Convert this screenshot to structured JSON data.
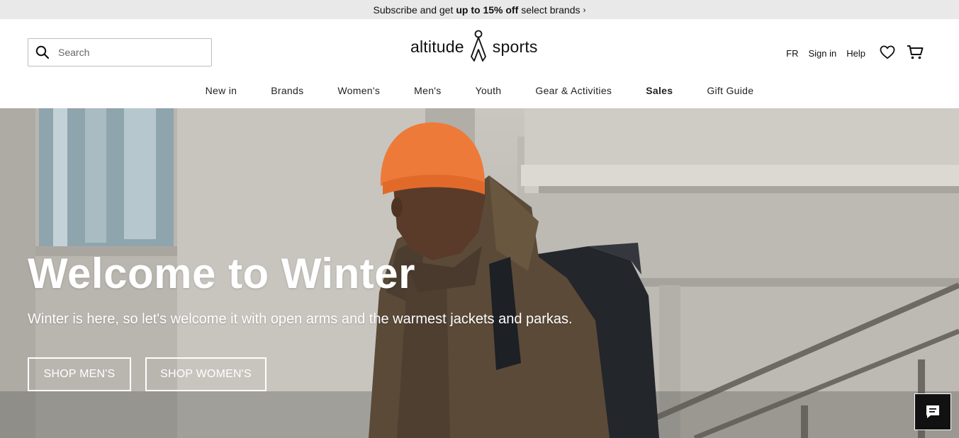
{
  "promo": {
    "prefix": "Subscribe and get",
    "highlight": "up to 15% off",
    "suffix": "select brands",
    "arrow": "›"
  },
  "search": {
    "placeholder": "Search",
    "icon": "search-icon"
  },
  "logo": {
    "left_word": "altitude",
    "right_word": "sports",
    "icon": "mountain-figure-icon"
  },
  "utils": {
    "lang": "FR",
    "sign_in": "Sign in",
    "help": "Help",
    "wishlist_icon": "heart-icon",
    "cart_icon": "cart-icon"
  },
  "nav": {
    "items": [
      {
        "label": "New in"
      },
      {
        "label": "Brands"
      },
      {
        "label": "Women's"
      },
      {
        "label": "Men's"
      },
      {
        "label": "Youth"
      },
      {
        "label": "Gear & Activities"
      },
      {
        "label": "Sales"
      },
      {
        "label": "Gift Guide"
      }
    ]
  },
  "hero": {
    "title": "Welcome to Winter",
    "subtitle": "Winter is here, so let's welcome it with open arms and the warmest jackets and parkas.",
    "buttons": {
      "men": "SHOP MEN'S",
      "women": "SHOP WOMEN'S"
    }
  },
  "chat": {
    "icon": "chat-icon"
  },
  "colors": {
    "promo_bg": "#e9e9e9",
    "hat": "#ee7a3a",
    "jacket": "#5b4a38",
    "text": "#111111"
  }
}
